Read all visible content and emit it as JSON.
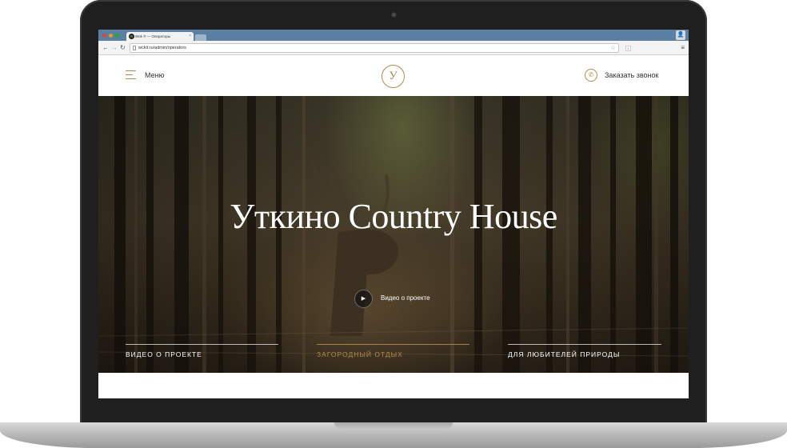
{
  "browser": {
    "tab_title": "Wok ® — Операторы",
    "favicon_letter": "W",
    "tab_close": "×",
    "url": "wckit.ru/admin/operators",
    "ext_badge": "1",
    "user_icon": "👤",
    "menu_icon": "≡",
    "back_icon": "←",
    "forward_icon": "→",
    "reload_icon": "↻",
    "star_icon": "☆"
  },
  "header": {
    "menu_label": "Меню",
    "logo_letter": "У",
    "phone_icon": "✆",
    "callback_label": "Заказать звонок",
    "accent_color": "#b08d4e"
  },
  "hero": {
    "title": "Уткино Country House",
    "play_icon": "▶",
    "play_label": "Видео о проекте",
    "tabs": [
      {
        "label": "ВИДЕО О ПРОЕКТЕ"
      },
      {
        "label": "ЗАГОРОДНЫЙ ОТДЫХ"
      },
      {
        "label": "ДЛЯ ЛЮБИТЕЛЕЙ ПРИРОДЫ"
      }
    ]
  }
}
